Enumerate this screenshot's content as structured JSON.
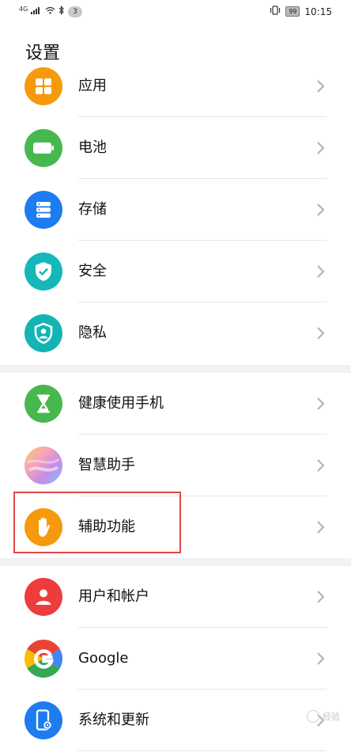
{
  "status_bar": {
    "network": "4G",
    "notification_count": "3",
    "battery": "99",
    "time": "10:15"
  },
  "page": {
    "title": "设置"
  },
  "sections": [
    {
      "items": [
        {
          "label": "应用",
          "icon": "apps-icon",
          "color": "#f59a0c"
        },
        {
          "label": "电池",
          "icon": "battery-icon",
          "color": "#47b84e"
        },
        {
          "label": "存储",
          "icon": "storage-icon",
          "color": "#1e7bf0"
        },
        {
          "label": "安全",
          "icon": "security-shield-icon",
          "color": "#15b8b8"
        },
        {
          "label": "隐私",
          "icon": "privacy-icon",
          "color": "#13b4b4"
        }
      ]
    },
    {
      "items": [
        {
          "label": "健康使用手机",
          "icon": "hourglass-icon",
          "color": "#47b84e"
        },
        {
          "label": "智慧助手",
          "icon": "smart-assistant-icon",
          "color": "#d58cd8"
        },
        {
          "label": "辅助功能",
          "icon": "hand-icon",
          "color": "#f59a0c"
        }
      ]
    },
    {
      "items": [
        {
          "label": "用户和帐户",
          "icon": "user-icon",
          "color": "#ee3c3c"
        },
        {
          "label": "Google",
          "icon": "google-icon",
          "color": "#ffffff"
        },
        {
          "label": "系统和更新",
          "icon": "system-update-icon",
          "color": "#1e7bf0"
        }
      ]
    }
  ],
  "highlight_color": "#e04848",
  "watermark": "经验"
}
